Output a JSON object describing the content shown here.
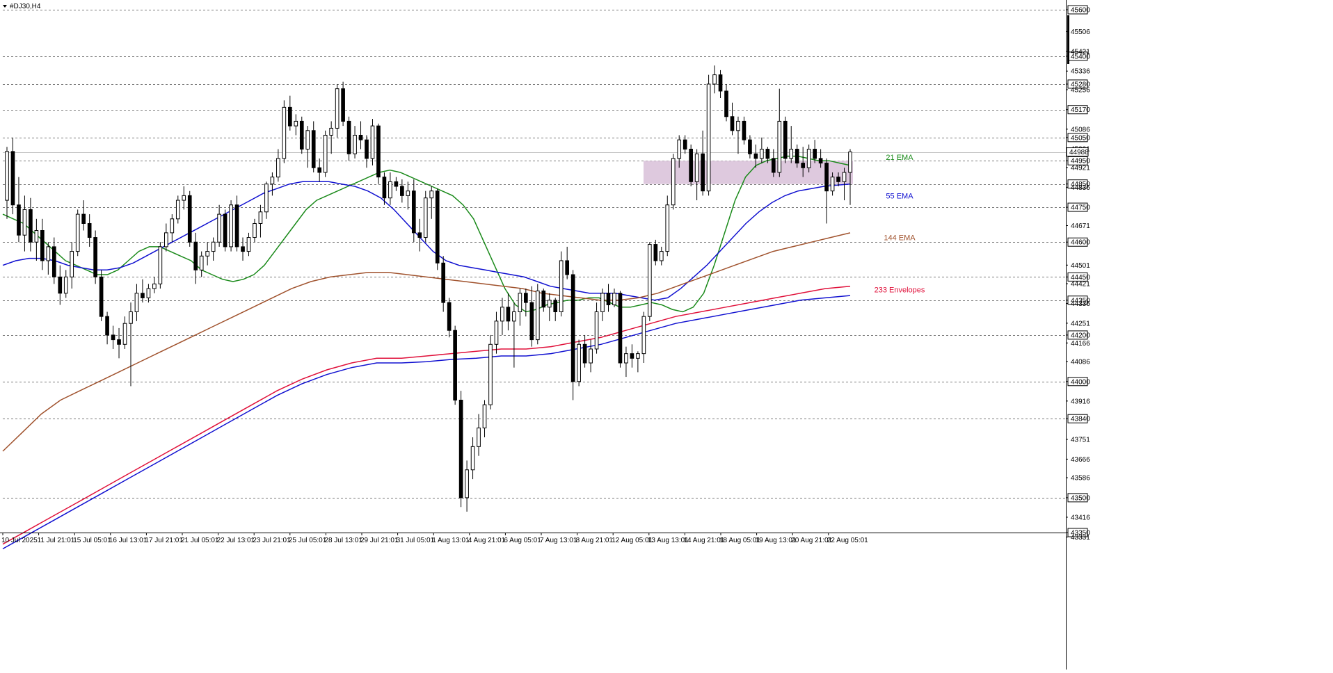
{
  "window": {
    "title": "#DJ30,H4"
  },
  "colors": {
    "background": "#ffffff",
    "candle_up": "#ffffff",
    "candle_down": "#000000",
    "candle_outline": "#000000",
    "ema21": "#1a8a1a",
    "ema55": "#1010d0",
    "ema144": "#a0522d",
    "envelope_upper": "#e0103a",
    "envelope_lower": "#1010d0",
    "zone": "#d8bfd8",
    "grid": "#7a7a7a"
  },
  "chart_data": {
    "type": "candlestick",
    "symbol": "#DJ30",
    "timeframe": "H4",
    "ylim": [
      43350,
      45600
    ],
    "grid": true,
    "price_ticks_major": [
      45600,
      45400,
      45280,
      45170,
      45050,
      44950,
      44850,
      44750,
      44600,
      44450,
      44350,
      44200,
      44000,
      43840,
      43500,
      43350
    ],
    "price_ticks_minor": [
      45506,
      45421,
      45336,
      45256,
      45086,
      45001,
      44921,
      44836,
      44671,
      44501,
      44421,
      44336,
      44251,
      44166,
      44086,
      43916,
      43751,
      43666,
      43586,
      43416,
      43331
    ],
    "current_price": 44988,
    "x_labels": [
      "10 Jul 2025",
      "11 Jul 21:01",
      "15 Jul 05:01",
      "16 Jul 13:01",
      "17 Jul 21:01",
      "21 Jul 05:01",
      "22 Jul 13:01",
      "23 Jul 21:01",
      "25 Jul 05:01",
      "28 Jul 13:01",
      "29 Jul 21:01",
      "31 Jul 05:01",
      "1 Aug 13:01",
      "4 Aug 21:01",
      "6 Aug 05:01",
      "7 Aug 13:01",
      "8 Aug 21:01",
      "12 Aug 05:01",
      "13 Aug 13:01",
      "14 Aug 21:01",
      "18 Aug 05:01",
      "19 Aug 13:01",
      "20 Aug 21:01",
      "22 Aug 05:01"
    ],
    "candles_ohlc": [
      [
        44780,
        45010,
        44700,
        44990
      ],
      [
        44990,
        45050,
        44720,
        44760
      ],
      [
        44760,
        44880,
        44600,
        44630
      ],
      [
        44630,
        44800,
        44560,
        44740
      ],
      [
        44740,
        44790,
        44560,
        44600
      ],
      [
        44600,
        44700,
        44520,
        44650
      ],
      [
        44650,
        44700,
        44480,
        44520
      ],
      [
        44520,
        44600,
        44460,
        44580
      ],
      [
        44580,
        44620,
        44420,
        44450
      ],
      [
        44450,
        44500,
        44330,
        44380
      ],
      [
        44380,
        44480,
        44360,
        44450
      ],
      [
        44450,
        44600,
        44400,
        44560
      ],
      [
        44560,
        44740,
        44540,
        44720
      ],
      [
        44720,
        44780,
        44650,
        44680
      ],
      [
        44680,
        44720,
        44580,
        44620
      ],
      [
        44620,
        44650,
        44420,
        44450
      ],
      [
        44450,
        44480,
        44260,
        44280
      ],
      [
        44280,
        44300,
        44160,
        44200
      ],
      [
        44200,
        44240,
        44140,
        44180
      ],
      [
        44180,
        44230,
        44100,
        44160
      ],
      [
        44160,
        44280,
        44140,
        44250
      ],
      [
        44250,
        44340,
        43980,
        44300
      ],
      [
        44300,
        44420,
        44260,
        44380
      ],
      [
        44380,
        44440,
        44340,
        44360
      ],
      [
        44360,
        44420,
        44340,
        44400
      ],
      [
        44400,
        44450,
        44380,
        44420
      ],
      [
        44420,
        44600,
        44400,
        44580
      ],
      [
        44580,
        44680,
        44560,
        44640
      ],
      [
        44640,
        44720,
        44600,
        44700
      ],
      [
        44700,
        44800,
        44680,
        44780
      ],
      [
        44780,
        44840,
        44740,
        44800
      ],
      [
        44800,
        44820,
        44580,
        44600
      ],
      [
        44600,
        44640,
        44420,
        44480
      ],
      [
        44480,
        44560,
        44450,
        44540
      ],
      [
        44540,
        44600,
        44500,
        44560
      ],
      [
        44560,
        44620,
        44520,
        44600
      ],
      [
        44600,
        44760,
        44580,
        44720
      ],
      [
        44720,
        44740,
        44560,
        44580
      ],
      [
        44580,
        44780,
        44560,
        44760
      ],
      [
        44760,
        44800,
        44560,
        44580
      ],
      [
        44580,
        44620,
        44520,
        44560
      ],
      [
        44560,
        44640,
        44540,
        44620
      ],
      [
        44620,
        44700,
        44600,
        44680
      ],
      [
        44680,
        44760,
        44620,
        44730
      ],
      [
        44730,
        44860,
        44700,
        44850
      ],
      [
        44850,
        44900,
        44800,
        44880
      ],
      [
        44880,
        45000,
        44860,
        44960
      ],
      [
        44960,
        45210,
        44940,
        45180
      ],
      [
        45180,
        45230,
        45080,
        45100
      ],
      [
        45100,
        45150,
        45060,
        45120
      ],
      [
        45120,
        45140,
        44980,
        45000
      ],
      [
        45000,
        45100,
        44920,
        45080
      ],
      [
        45080,
        45120,
        44900,
        44920
      ],
      [
        44920,
        44960,
        44860,
        44900
      ],
      [
        44900,
        45080,
        44880,
        45060
      ],
      [
        45060,
        45120,
        44980,
        45090
      ],
      [
        45090,
        45280,
        45050,
        45260
      ],
      [
        45260,
        45290,
        45100,
        45120
      ],
      [
        45120,
        45140,
        44950,
        44980
      ],
      [
        44980,
        45100,
        44960,
        45060
      ],
      [
        45060,
        45120,
        45000,
        45040
      ],
      [
        45040,
        45060,
        44920,
        44960
      ],
      [
        44960,
        45130,
        44930,
        45100
      ],
      [
        45100,
        45110,
        44850,
        44880
      ],
      [
        44880,
        44900,
        44760,
        44790
      ],
      [
        44790,
        44900,
        44760,
        44860
      ],
      [
        44860,
        44880,
        44820,
        44840
      ],
      [
        44840,
        44870,
        44770,
        44800
      ],
      [
        44800,
        44860,
        44740,
        44820
      ],
      [
        44820,
        44870,
        44600,
        44640
      ],
      [
        44640,
        44700,
        44560,
        44620
      ],
      [
        44620,
        44820,
        44600,
        44790
      ],
      [
        44790,
        44840,
        44700,
        44820
      ],
      [
        44820,
        44830,
        44480,
        44510
      ],
      [
        44510,
        44540,
        44300,
        44340
      ],
      [
        44340,
        44360,
        44190,
        44220
      ],
      [
        44220,
        44240,
        43900,
        43920
      ],
      [
        43920,
        43960,
        43460,
        43500
      ],
      [
        43500,
        43660,
        43440,
        43620
      ],
      [
        43620,
        43760,
        43580,
        43720
      ],
      [
        43720,
        43860,
        43680,
        43800
      ],
      [
        43800,
        43920,
        43760,
        43900
      ],
      [
        43900,
        44200,
        43880,
        44160
      ],
      [
        44160,
        44300,
        44120,
        44260
      ],
      [
        44260,
        44360,
        44200,
        44320
      ],
      [
        44320,
        44380,
        44220,
        44260
      ],
      [
        44260,
        44340,
        44060,
        44300
      ],
      [
        44300,
        44400,
        44240,
        44380
      ],
      [
        44380,
        44400,
        44280,
        44340
      ],
      [
        44340,
        44410,
        44150,
        44180
      ],
      [
        44180,
        44420,
        44160,
        44390
      ],
      [
        44390,
        44400,
        44300,
        44320
      ],
      [
        44320,
        44380,
        44260,
        44350
      ],
      [
        44350,
        44360,
        44260,
        44300
      ],
      [
        44300,
        44560,
        44280,
        44520
      ],
      [
        44520,
        44580,
        44440,
        44460
      ],
      [
        44460,
        44480,
        43920,
        44000
      ],
      [
        44000,
        44180,
        43980,
        44160
      ],
      [
        44160,
        44200,
        44060,
        44080
      ],
      [
        44080,
        44180,
        44040,
        44140
      ],
      [
        44140,
        44340,
        44120,
        44300
      ],
      [
        44300,
        44400,
        44260,
        44380
      ],
      [
        44380,
        44420,
        44300,
        44330
      ],
      [
        44330,
        44400,
        44320,
        44380
      ],
      [
        44380,
        44390,
        44060,
        44080
      ],
      [
        44080,
        44150,
        44020,
        44120
      ],
      [
        44120,
        44160,
        44060,
        44100
      ],
      [
        44100,
        44130,
        44040,
        44120
      ],
      [
        44120,
        44300,
        44080,
        44280
      ],
      [
        44280,
        44600,
        44260,
        44590
      ],
      [
        44590,
        44610,
        44500,
        44520
      ],
      [
        44520,
        44580,
        44500,
        44560
      ],
      [
        44560,
        44800,
        44540,
        44760
      ],
      [
        44760,
        44980,
        44740,
        44960
      ],
      [
        44960,
        45060,
        44920,
        45040
      ],
      [
        45040,
        45060,
        44980,
        45000
      ],
      [
        45000,
        45020,
        44840,
        44860
      ],
      [
        44860,
        45000,
        44780,
        44980
      ],
      [
        44980,
        45080,
        44800,
        44820
      ],
      [
        44820,
        45320,
        44800,
        45280
      ],
      [
        45280,
        45360,
        45240,
        45320
      ],
      [
        45320,
        45340,
        45220,
        45250
      ],
      [
        45250,
        45280,
        45120,
        45140
      ],
      [
        45140,
        45200,
        45060,
        45080
      ],
      [
        45080,
        45140,
        44980,
        45120
      ],
      [
        45120,
        45140,
        45020,
        45040
      ],
      [
        45040,
        45060,
        44960,
        44980
      ],
      [
        44980,
        45020,
        44920,
        44960
      ],
      [
        44960,
        45050,
        44940,
        45000
      ],
      [
        45000,
        45010,
        44940,
        44960
      ],
      [
        44960,
        45000,
        44880,
        44900
      ],
      [
        44900,
        45260,
        44880,
        45120
      ],
      [
        45120,
        45140,
        44940,
        44960
      ],
      [
        44960,
        45100,
        44940,
        45000
      ],
      [
        45000,
        45020,
        44920,
        44940
      ],
      [
        44940,
        45010,
        44880,
        44920
      ],
      [
        44920,
        45020,
        44900,
        45000
      ],
      [
        45000,
        45040,
        44940,
        44960
      ],
      [
        44960,
        45000,
        44920,
        44940
      ],
      [
        44940,
        44960,
        44680,
        44820
      ],
      [
        44820,
        44900,
        44800,
        44880
      ],
      [
        44880,
        44900,
        44840,
        44860
      ],
      [
        44860,
        44920,
        44780,
        44900
      ],
      [
        44900,
        45000,
        44760,
        44988
      ]
    ],
    "series": [
      {
        "name": "21 EMA",
        "color": "#1a8a1a",
        "values": [
          44720,
          44700,
          44680,
          44640,
          44600,
          44560,
          44520,
          44500,
          44480,
          44460,
          44460,
          44480,
          44520,
          44560,
          44580,
          44580,
          44560,
          44540,
          44520,
          44480,
          44460,
          44440,
          44430,
          44440,
          44460,
          44500,
          44560,
          44620,
          44680,
          44740,
          44780,
          44800,
          44820,
          44840,
          44860,
          44880,
          44900,
          44910,
          44900,
          44880,
          44860,
          44840,
          44820,
          44800,
          44760,
          44700,
          44600,
          44500,
          44400,
          44330,
          44300,
          44310,
          44330,
          44340,
          44350,
          44350,
          44360,
          44360,
          44340,
          44320,
          44320,
          44330,
          44340,
          44330,
          44310,
          44300,
          44320,
          44380,
          44500,
          44640,
          44780,
          44880,
          44930,
          44950,
          44960,
          44970,
          44970,
          44960,
          44950,
          44950,
          44940,
          44930
        ]
      },
      {
        "name": "55 EMA",
        "color": "#1010d0",
        "values": [
          44500,
          44520,
          44530,
          44530,
          44520,
          44500,
          44490,
          44480,
          44480,
          44490,
          44510,
          44540,
          44570,
          44600,
          44630,
          44660,
          44690,
          44720,
          44750,
          44780,
          44810,
          44830,
          44850,
          44860,
          44860,
          44860,
          44850,
          44840,
          44820,
          44790,
          44740,
          44680,
          44620,
          44560,
          44520,
          44500,
          44490,
          44480,
          44470,
          44460,
          44450,
          44430,
          44410,
          44400,
          44390,
          44380,
          44380,
          44380,
          44370,
          44360,
          44350,
          44360,
          44400,
          44450,
          44500,
          44560,
          44620,
          44680,
          44730,
          44770,
          44800,
          44820,
          44830,
          44840,
          44845,
          44850
        ]
      },
      {
        "name": "144 EMA",
        "color": "#a0522d",
        "values": [
          43700,
          43780,
          43860,
          43920,
          43960,
          44000,
          44040,
          44080,
          44120,
          44160,
          44200,
          44240,
          44280,
          44320,
          44360,
          44400,
          44430,
          44450,
          44460,
          44470,
          44470,
          44460,
          44450,
          44440,
          44430,
          44420,
          44410,
          44400,
          44380,
          44370,
          44360,
          44350,
          44350,
          44360,
          44380,
          44410,
          44440,
          44470,
          44500,
          44530,
          44560,
          44580,
          44600,
          44620,
          44640
        ]
      },
      {
        "name": "233 Envelopes",
        "color": "#e0103a",
        "values": [
          43300,
          43360,
          43420,
          43480,
          43540,
          43600,
          43660,
          43720,
          43780,
          43840,
          43900,
          43960,
          44010,
          44050,
          44080,
          44100,
          44100,
          44110,
          44120,
          44130,
          44140,
          44140,
          44150,
          44170,
          44190,
          44220,
          44250,
          44280,
          44300,
          44320,
          44340,
          44360,
          44380,
          44400,
          44410
        ]
      },
      {
        "name": "233 Envelopes",
        "color": "#1010d0",
        "values": [
          43280,
          43340,
          43400,
          43460,
          43520,
          43580,
          43640,
          43700,
          43760,
          43820,
          43880,
          43940,
          43990,
          44030,
          44060,
          44080,
          44080,
          44085,
          44095,
          44100,
          44110,
          44110,
          44120,
          44140,
          44160,
          44190,
          44220,
          44250,
          44270,
          44290,
          44310,
          44330,
          44350,
          44360,
          44370
        ]
      }
    ],
    "zone": {
      "y_top": 44950,
      "y_bottom": 44850
    },
    "labels": {
      "ema21": "21 EMA",
      "ema55": "55 EMA",
      "ema144": "144 EMA",
      "envelopes": "233 Envelopes"
    }
  }
}
